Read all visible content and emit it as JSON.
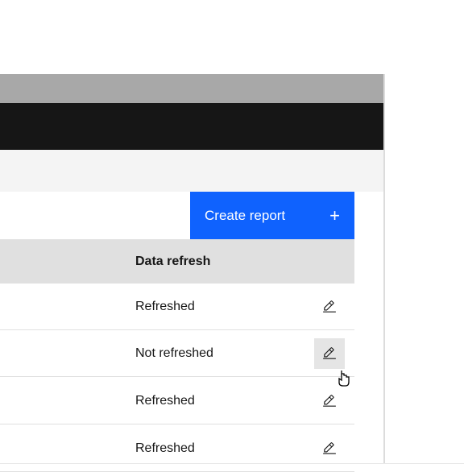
{
  "actions": {
    "create_report_label": "Create report"
  },
  "table": {
    "header": "Data refresh",
    "rows": [
      {
        "status": "Refreshed"
      },
      {
        "status": "Not refreshed"
      },
      {
        "status": "Refreshed"
      },
      {
        "status": "Refreshed"
      }
    ]
  },
  "icons": {
    "plus": "plus-icon",
    "edit": "edit-icon",
    "cursor": "pointer-cursor"
  }
}
